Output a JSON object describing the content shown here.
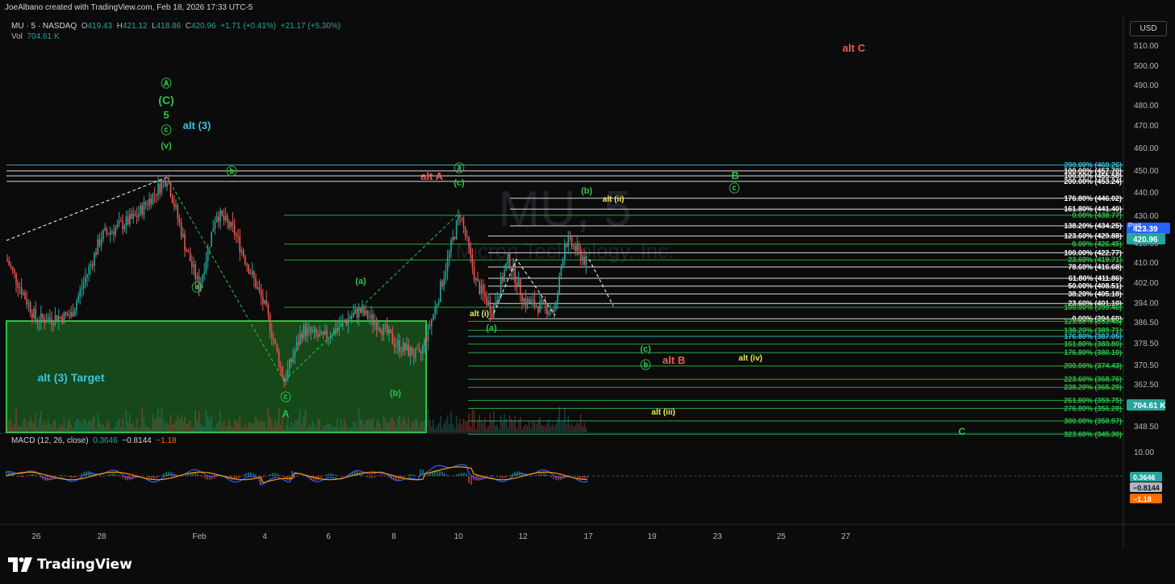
{
  "header": {
    "credit": "JoeAlbano created with TradingView.com, Feb 18, 2026 17:33 UTC-5"
  },
  "legend": {
    "symbol": "MU · 5 · NASDAQ",
    "open_label": "O",
    "open": "419.43",
    "high_label": "H",
    "high": "421.12",
    "low_label": "L",
    "low": "418.86",
    "close_label": "C",
    "close": "420.96",
    "change": "+1.71 (+0.41%)",
    "change2": "+21.17 (+5.30%)",
    "vol_label": "Vol",
    "vol": "704.61 K"
  },
  "macd_legend": {
    "label": "MACD (12, 26, close)",
    "v1": "0.3646",
    "v2": "−0.8144",
    "v3": "−1.18"
  },
  "currency_button": "USD",
  "watermark": {
    "ticker": "MU, 5",
    "name": "Micron Technology, Inc."
  },
  "footer": {
    "logo_text": "TradingView"
  },
  "colors": {
    "bg": "#0b0b0b",
    "up": "#26a69a",
    "down": "#ef5350",
    "green": "#2ec24a",
    "red": "#f05a5a",
    "cyan": "#39c3e0",
    "yellow": "#f5e663",
    "white": "#ffffff"
  },
  "chart_data": [
    {
      "type": "candlestick",
      "title": "MU · 5 · NASDAQ",
      "y_axis_ticks": [
        "510.00",
        "500.00",
        "490.00",
        "480.00",
        "470.00",
        "460.00",
        "450.00",
        "440.00",
        "430.00",
        "418.00",
        "410.00",
        "402.00",
        "394.00",
        "386.50",
        "378.50",
        "370.50",
        "362.50",
        "355.50",
        "348.50"
      ],
      "ylim": [
        346,
        516
      ],
      "x_axis_ticks": [
        "26",
        "28",
        "Feb",
        "4",
        "6",
        "8",
        "10",
        "12",
        "17",
        "19",
        "23",
        "25",
        "27"
      ],
      "price_badges": [
        {
          "label": "Post",
          "value": "423.39",
          "color": "#2962ff"
        },
        {
          "label": "",
          "value": "420.96",
          "color": "#26a69a"
        },
        {
          "label": "",
          "value": "704.61 K",
          "color": "#26a69a"
        }
      ],
      "fib_levels_upper": [
        {
          "label": "200.00% (460.26)",
          "y": 460.26,
          "color": "#39c3e0"
        },
        {
          "label": "100.00% (457.70)",
          "y": 457.7,
          "color": "#ffffff"
        },
        {
          "label": "100.00% (455.58)",
          "y": 455.58,
          "color": "#ffffff"
        },
        {
          "label": "200.00% (453.24)",
          "y": 453.24,
          "color": "#ffffff"
        },
        {
          "label": "176.80% (446.02)",
          "y": 446.02,
          "color": "#ffffff"
        },
        {
          "label": "161.80% (441.40)",
          "y": 441.4,
          "color": "#ffffff"
        },
        {
          "label": "0.00% (438.77)",
          "y": 438.77,
          "color": "#2ec24a"
        },
        {
          "label": "138.20% (434.25)",
          "y": 434.25,
          "color": "#ffffff"
        },
        {
          "label": "123.60% (429.88)",
          "y": 429.88,
          "color": "#ffffff"
        },
        {
          "label": "0.00% (426.45)",
          "y": 426.45,
          "color": "#2ec24a"
        },
        {
          "label": "100.00% (422.77)",
          "y": 422.77,
          "color": "#ffffff"
        },
        {
          "label": "23.60% (419.71)",
          "y": 419.71,
          "color": "#2ec24a"
        },
        {
          "label": "78.60% (416.68)",
          "y": 416.68,
          "color": "#ffffff"
        },
        {
          "label": "61.80% (411.86)",
          "y": 411.86,
          "color": "#ffffff"
        },
        {
          "label": "50.00% (408.51)",
          "y": 408.51,
          "color": "#ffffff"
        },
        {
          "label": "38.20% (405.18)",
          "y": 405.18,
          "color": "#ffffff"
        },
        {
          "label": "23.60% (401.10)",
          "y": 401.1,
          "color": "#ffffff"
        },
        {
          "label": "100.00% (399.46)",
          "y": 399.46,
          "color": "#2ec24a"
        },
        {
          "label": "0.00% (394.60)",
          "y": 394.6,
          "color": "#ffffff"
        }
      ],
      "fib_levels_lower": [
        {
          "label": "123.60% (393.48)",
          "y": 393.48,
          "color": "#2ec24a"
        },
        {
          "label": "138.20% (389.71)",
          "y": 389.71,
          "color": "#2ec24a"
        },
        {
          "label": "176.80% (387.05)",
          "y": 387.05,
          "color": "#39c3e0"
        },
        {
          "label": "161.80% (383.80)",
          "y": 383.8,
          "color": "#2ec24a"
        },
        {
          "label": "176.80% (380.10)",
          "y": 380.1,
          "color": "#2ec24a"
        },
        {
          "label": "200.00% (374.43)",
          "y": 374.43,
          "color": "#2ec24a"
        },
        {
          "label": "223.60% (368.76)",
          "y": 368.76,
          "color": "#2ec24a"
        },
        {
          "label": "238.20% (365.29)",
          "y": 365.29,
          "color": "#2ec24a"
        },
        {
          "label": "261.80% (359.75)",
          "y": 359.75,
          "color": "#2ec24a"
        },
        {
          "label": "276.80% (356.28)",
          "y": 356.28,
          "color": "#2ec24a"
        },
        {
          "label": "300.00% (350.97)",
          "y": 350.97,
          "color": "#2ec24a"
        },
        {
          "label": "323.60% (345.30)",
          "y": 345.3,
          "color": "#2ec24a"
        }
      ],
      "annotations": [
        {
          "text": "alt C",
          "color": "#f05a5a"
        },
        {
          "text": "Ⓐ",
          "color": "#2ec24a"
        },
        {
          "text": "(C)",
          "color": "#2ec24a"
        },
        {
          "text": "5",
          "color": "#2ec24a"
        },
        {
          "text": "ⓒ",
          "color": "#2ec24a"
        },
        {
          "text": "alt (3)",
          "color": "#39c3e0"
        },
        {
          "text": "(v)",
          "color": "#2ec24a"
        },
        {
          "text": "ⓑ",
          "color": "#2ec24a"
        },
        {
          "text": "ⓐ",
          "color": "#2ec24a"
        },
        {
          "text": "(a)",
          "color": "#2ec24a"
        },
        {
          "text": "alt A",
          "color": "#f05a5a"
        },
        {
          "text": "ⓐ",
          "color": "#2ec24a"
        },
        {
          "text": "(c)",
          "color": "#2ec24a"
        },
        {
          "text": "(b)",
          "color": "#2ec24a"
        },
        {
          "text": "alt (ii)",
          "color": "#f5e663"
        },
        {
          "text": "B",
          "color": "#2ec24a"
        },
        {
          "text": "ⓒ",
          "color": "#2ec24a"
        },
        {
          "text": "alt (i)",
          "color": "#f5e663"
        },
        {
          "text": "(a)",
          "color": "#2ec24a"
        },
        {
          "text": "(c)",
          "color": "#2ec24a"
        },
        {
          "text": "ⓑ",
          "color": "#2ec24a"
        },
        {
          "text": "alt B",
          "color": "#f05a5a"
        },
        {
          "text": "alt (iv)",
          "color": "#f5e663"
        },
        {
          "text": "alt (iii)",
          "color": "#f5e663"
        },
        {
          "text": "ⓒ",
          "color": "#2ec24a"
        },
        {
          "text": "A",
          "color": "#2ec24a"
        },
        {
          "text": "(b)",
          "color": "#2ec24a"
        },
        {
          "text": "alt (3) Target",
          "color": "#39c3e0"
        },
        {
          "text": "C",
          "color": "#2ec24a"
        }
      ]
    },
    {
      "type": "line",
      "title": "MACD (12, 26, close)",
      "y_axis_ticks": [
        "10.00",
        "-10.00"
      ],
      "ylim": [
        -14,
        14
      ],
      "series": [
        {
          "name": "MACD",
          "color": "#2962ff"
        },
        {
          "name": "Signal",
          "color": "#ff9800"
        }
      ],
      "value_badges": [
        {
          "value": "0.3646",
          "color": "#26a69a"
        },
        {
          "value": "−0.8144",
          "color": "#b2b5be"
        },
        {
          "value": "−1.18",
          "color": "#ff6d00"
        }
      ]
    }
  ]
}
